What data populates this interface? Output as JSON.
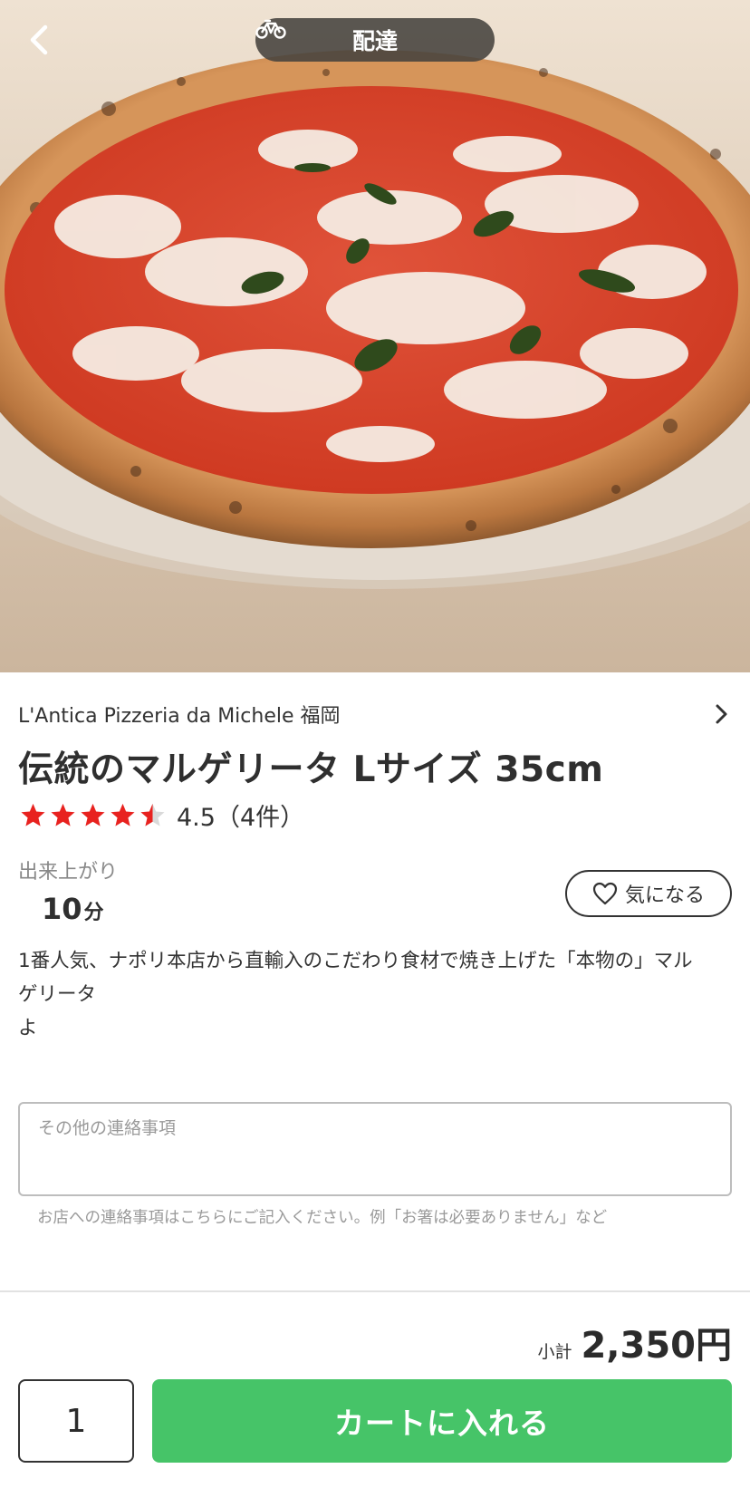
{
  "header": {
    "mode_label": "配達",
    "back_icon": "chevron-left-icon",
    "mode_icon": "bicycle-icon"
  },
  "hero": {
    "image": "margherita-pizza-photo"
  },
  "shop": {
    "name": "L'Antica Pizzeria da Michele 福岡",
    "chevron_icon": "chevron-right-icon"
  },
  "item": {
    "title": "伝統のマルゲリータ Lサイズ 35cm",
    "rating": 4.5,
    "rating_text": "4.5（4件）",
    "prep_label": "出来上がり",
    "prep_value": "10",
    "prep_unit": "分",
    "favorite_label": "気になる",
    "description": "1番人気、ナポリ本店から直輸入のこだわり食材で焼き上げた「本物の」マル\nゲリータ\nよ"
  },
  "note": {
    "placeholder": "その他の連絡事項",
    "value": "",
    "hint": "お店への連絡事項はこちらにご記入ください。例「お箸は必要ありません」など"
  },
  "footer": {
    "subtotal_label": "小計",
    "subtotal_value": "2,350円",
    "quantity": "1",
    "cart_button_label": "カートに入れる"
  },
  "colors": {
    "accent": "#46c468",
    "star": "#e8221f",
    "star_empty": "#d9d9d9",
    "pill_bg": "#46423e"
  }
}
